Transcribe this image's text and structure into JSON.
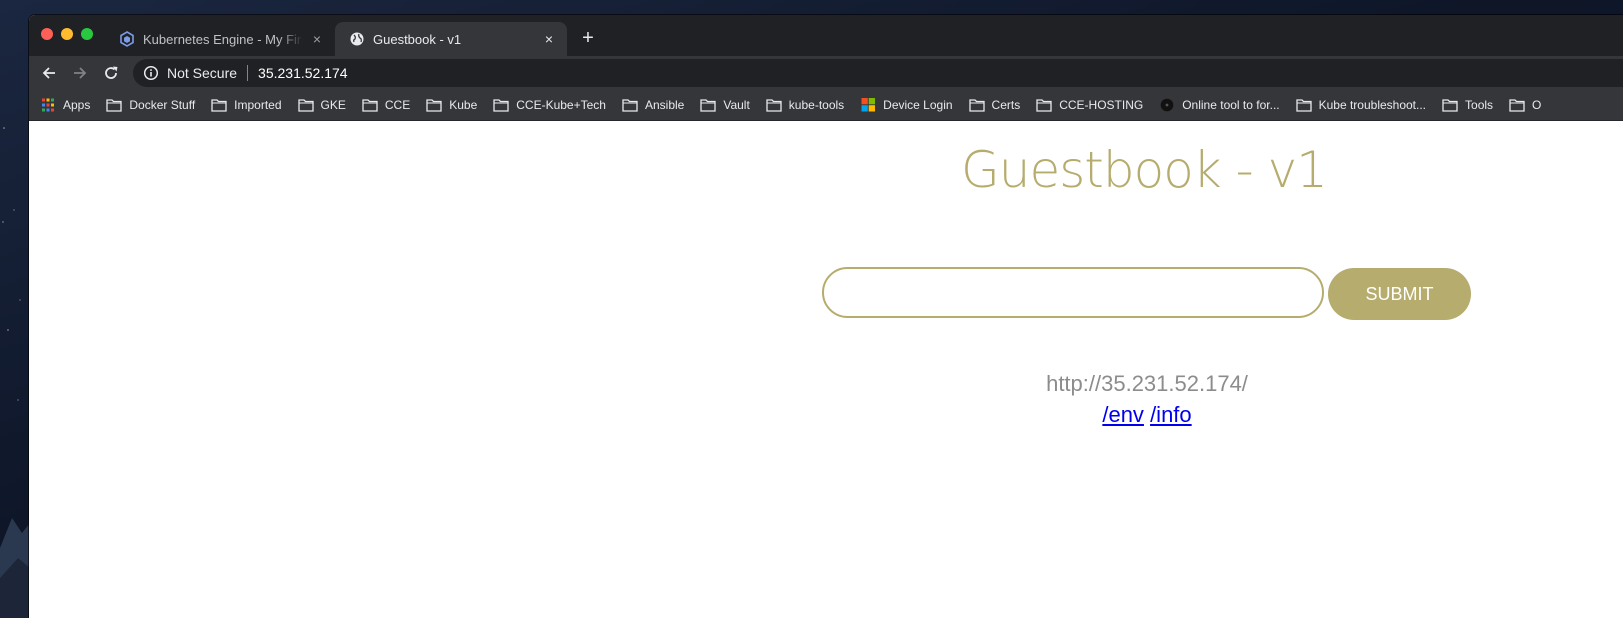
{
  "tabs": [
    {
      "title": "Kubernetes Engine - My First Project",
      "close": "×"
    },
    {
      "title": "Guestbook - v1",
      "close": "×"
    }
  ],
  "new_tab": "+",
  "omnibox": {
    "security": "Not Secure",
    "url": "35.231.52.174"
  },
  "bookmarks": [
    {
      "label": "Apps",
      "icon": "apps-grid-icon"
    },
    {
      "label": "Docker Stuff",
      "icon": "folder-icon"
    },
    {
      "label": "Imported",
      "icon": "folder-icon"
    },
    {
      "label": "GKE",
      "icon": "folder-icon"
    },
    {
      "label": "CCE",
      "icon": "folder-icon"
    },
    {
      "label": "Kube",
      "icon": "folder-icon"
    },
    {
      "label": "CCE-Kube+Tech",
      "icon": "folder-icon"
    },
    {
      "label": "Ansible",
      "icon": "folder-icon"
    },
    {
      "label": "Vault",
      "icon": "folder-icon"
    },
    {
      "label": "kube-tools",
      "icon": "folder-icon"
    },
    {
      "label": "Device Login",
      "icon": "microsoft-logo-icon"
    },
    {
      "label": "Certs",
      "icon": "folder-icon"
    },
    {
      "label": "CCE-HOSTING",
      "icon": "folder-icon"
    },
    {
      "label": "Online tool to for...",
      "icon": "dark-circle-icon"
    },
    {
      "label": "Kube troubleshoot...",
      "icon": "folder-icon"
    },
    {
      "label": "Tools",
      "icon": "folder-icon"
    },
    {
      "label": "O",
      "icon": "folder-icon"
    }
  ],
  "page": {
    "title": "Guestbook - v1",
    "input_value": "",
    "submit_label": "SUBMIT",
    "host_url": "http://35.231.52.174/",
    "link_env": "/env",
    "link_info": "/info"
  },
  "colors": {
    "accent": "#b6ac6e",
    "link": "#0000ee",
    "chrome_dark": "#202124",
    "chrome_toolbar": "#35363a"
  }
}
